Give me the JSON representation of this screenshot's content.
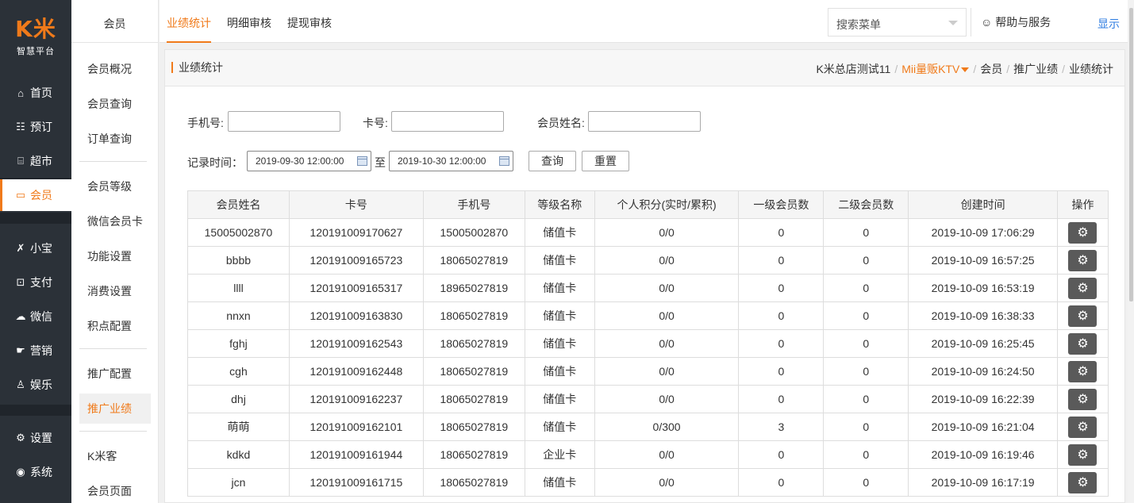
{
  "brand": {
    "logo": "K米",
    "subtitle": "智慧平台"
  },
  "nav": [
    {
      "label": "首页",
      "icon": "dashboard-icon",
      "glyph": "⌂"
    },
    {
      "label": "预订",
      "icon": "booking-icon",
      "glyph": "☷"
    },
    {
      "label": "超市",
      "icon": "supermarket-icon",
      "glyph": "⌸"
    },
    {
      "label": "会员",
      "icon": "member-card-icon",
      "glyph": "▭"
    },
    {
      "label": "小宝",
      "icon": "xiaobao-icon",
      "glyph": "✗"
    },
    {
      "label": "支付",
      "icon": "payment-icon",
      "glyph": "⊡"
    },
    {
      "label": "微信",
      "icon": "wechat-icon",
      "glyph": "☁"
    },
    {
      "label": "营销",
      "icon": "marketing-icon",
      "glyph": "☛"
    },
    {
      "label": "娱乐",
      "icon": "entertainment-icon",
      "glyph": "♙"
    },
    {
      "label": "设置",
      "icon": "settings-icon",
      "glyph": "⚙"
    },
    {
      "label": "系统",
      "icon": "system-icon",
      "glyph": "◉"
    }
  ],
  "subnav": {
    "title": "会员",
    "items": [
      "会员概况",
      "会员查询",
      "订单查询",
      "会员等级",
      "微信会员卡",
      "功能设置",
      "消费设置",
      "积点配置",
      "推广配置",
      "推广业绩",
      "K米客",
      "会员页面"
    ]
  },
  "tabs": [
    "业绩统计",
    "明细审核",
    "提现审核"
  ],
  "search": {
    "placeholder": "搜索菜单"
  },
  "help": {
    "label": "帮助与服务",
    "icon": "smile-icon"
  },
  "show_link": "显示",
  "page": {
    "title": "业绩统计",
    "breadcrumb": {
      "shop": "K米总店测试11",
      "store": "Mii量贩KTV",
      "c1": "会员",
      "c2": "推广业绩",
      "c3": "业绩统计"
    }
  },
  "filters": {
    "phone_label": "手机号:",
    "card_label": "卡号:",
    "name_label": "会员姓名:",
    "time_label": "记录时间：",
    "start": "2019-09-30 12:00:00",
    "to": "至",
    "end": "2019-10-30 12:00:00",
    "query_btn": "查询",
    "reset_btn": "重置"
  },
  "table": {
    "columns": [
      "会员姓名",
      "卡号",
      "手机号",
      "等级名称",
      "个人积分(实时/累积)",
      "一级会员数",
      "二级会员数",
      "创建时间",
      "操作"
    ],
    "rows": [
      [
        "15005002870",
        "120191009170627",
        "15005002870",
        "储值卡",
        "0/0",
        "0",
        "0",
        "2019-10-09 17:06:29"
      ],
      [
        "bbbb",
        "120191009165723",
        "18065027819",
        "储值卡",
        "0/0",
        "0",
        "0",
        "2019-10-09 16:57:25"
      ],
      [
        "llll",
        "120191009165317",
        "18965027819",
        "储值卡",
        "0/0",
        "0",
        "0",
        "2019-10-09 16:53:19"
      ],
      [
        "nnxn",
        "120191009163830",
        "18065027819",
        "储值卡",
        "0/0",
        "0",
        "0",
        "2019-10-09 16:38:33"
      ],
      [
        "fghj",
        "120191009162543",
        "18065027819",
        "储值卡",
        "0/0",
        "0",
        "0",
        "2019-10-09 16:25:45"
      ],
      [
        "cgh",
        "120191009162448",
        "18065027819",
        "储值卡",
        "0/0",
        "0",
        "0",
        "2019-10-09 16:24:50"
      ],
      [
        "dhj",
        "120191009162237",
        "18065027819",
        "储值卡",
        "0/0",
        "0",
        "0",
        "2019-10-09 16:22:39"
      ],
      [
        "萌萌",
        "120191009162101",
        "18065027819",
        "储值卡",
        "0/300",
        "3",
        "0",
        "2019-10-09 16:21:04"
      ],
      [
        "kdkd",
        "120191009161944",
        "18065027819",
        "企业卡",
        "0/0",
        "0",
        "0",
        "2019-10-09 16:19:46"
      ],
      [
        "jcn",
        "120191009161715",
        "18065027819",
        "储值卡",
        "0/0",
        "0",
        "0",
        "2019-10-09 16:17:19"
      ]
    ]
  },
  "colors": {
    "accent": "#f07a1a",
    "sidebar": "#2b3138",
    "link": "#2f7de1"
  }
}
